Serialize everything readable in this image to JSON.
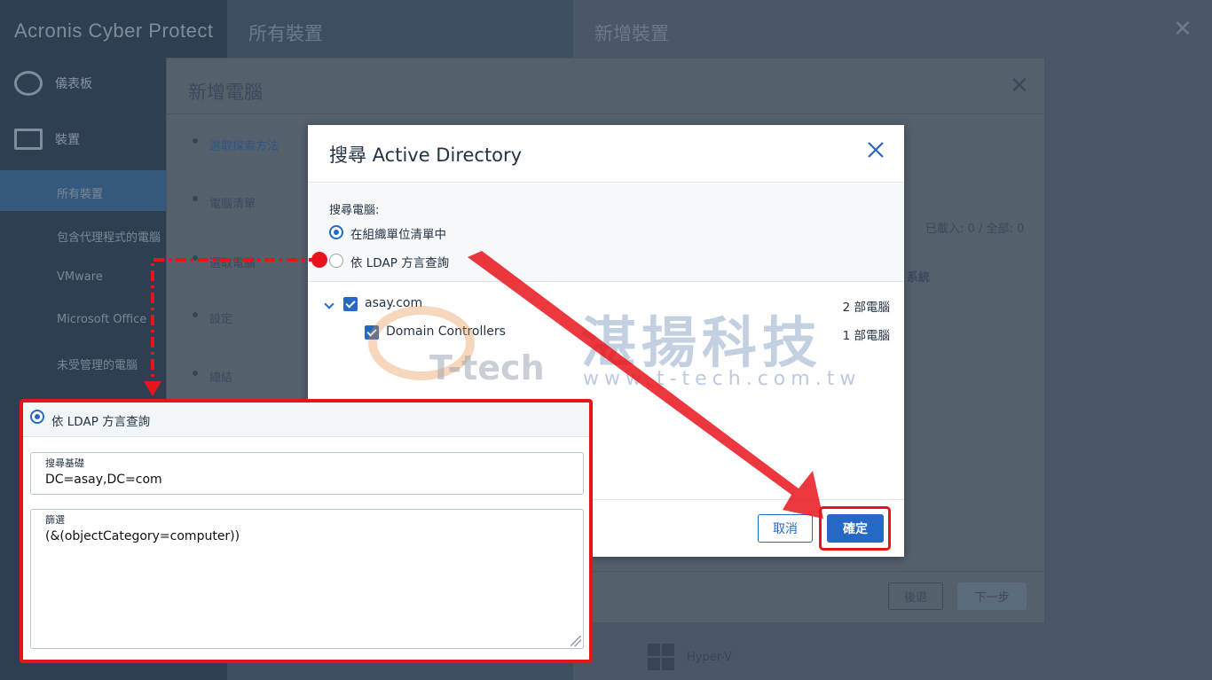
{
  "sidebar": {
    "brand": "Acronis Cyber Protect",
    "items": [
      {
        "label": "儀表板",
        "icon": "dashboard-icon"
      },
      {
        "label": "裝置",
        "icon": "monitor-icon"
      }
    ],
    "sub_items": [
      "所有裝置",
      "包含代理程式的電腦",
      "VMware",
      "Microsoft Office",
      "未受管理的電腦"
    ]
  },
  "panels": {
    "all_devices_title": "所有裝置",
    "add_devices_title": "新增裝置",
    "add_computer_title": "新增電腦",
    "steps": [
      "選取探索方法",
      "電腦清單",
      "選取電腦",
      "設定",
      "總結"
    ],
    "loaded_text": "已載入: 0 / 全部: 0",
    "system_text": "系統",
    "back_label": "後退",
    "next_label": "下一步",
    "hyperv_label": "Hyper-V"
  },
  "dialog": {
    "title": "搜尋 Active Directory",
    "search_label": "搜尋電腦:",
    "option_ou": "在組織單位清單中",
    "option_ldap": "依 LDAP 方言查詢",
    "selected_option": "option_ou",
    "tree": [
      {
        "label": "asay.com",
        "count": "2 部電腦",
        "checked": true,
        "expanded": true
      },
      {
        "label": "Domain Controllers",
        "count": "1 部電腦",
        "checked": true
      }
    ],
    "cancel_label": "取消",
    "ok_label": "確定"
  },
  "watermark": {
    "name_cn": "湛揚科技",
    "url": "www.t-tech.com.tw",
    "logo_text": "T-tech"
  },
  "callout": {
    "option_ldap": "依 LDAP 方言查詢",
    "search_base_label": "搜尋基礎",
    "search_base_value": "DC=asay,DC=com",
    "filter_label": "篩選",
    "filter_value": "(&(objectCategory=computer))"
  },
  "colors": {
    "accent": "#2668c5",
    "highlight": "#e8141b",
    "sidebar": "#2e3f51"
  }
}
